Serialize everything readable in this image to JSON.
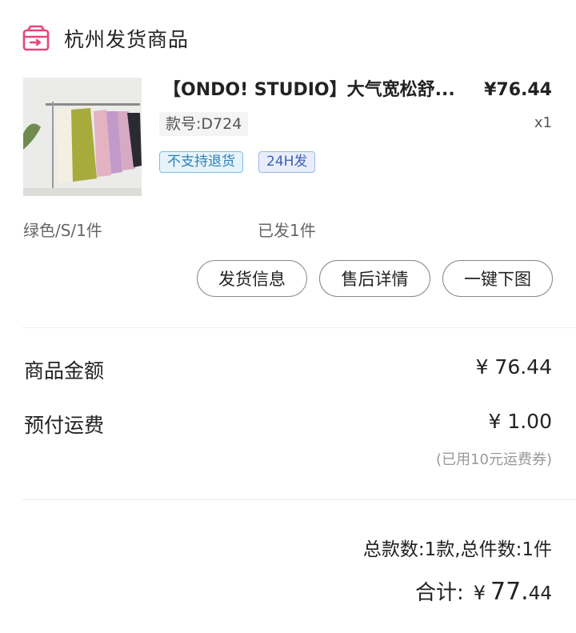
{
  "header": {
    "icon": "shop-package-icon",
    "title": "杭州发货商品"
  },
  "product": {
    "title": "【ONDO! STUDIO】大气宽松舒...",
    "price": "¥76.44",
    "style_no": "款号:D724",
    "quantity": "x1",
    "tags": [
      "不支持退货",
      "24H发"
    ],
    "spec": "绿色/S/1件",
    "shipped": "已发1件"
  },
  "actions": {
    "shipping_info": "发货信息",
    "after_sales": "售后详情",
    "download_images": "一键下图"
  },
  "amounts": {
    "goods_label": "商品金额",
    "goods_value": "¥ 76.44",
    "freight_label": "预付运费",
    "freight_value": "¥ 1.00",
    "freight_note": "(已用10元运费券)"
  },
  "footer": {
    "summary": "总款数:1款,总件数:1件",
    "total_label": "合计:",
    "total_currency": "¥",
    "total_int": "77.",
    "total_dec": "44"
  },
  "colors": {
    "accent": "#e8457a",
    "tag_blue": "#2e7fb5",
    "tag_indigo": "#3f5fb5"
  }
}
